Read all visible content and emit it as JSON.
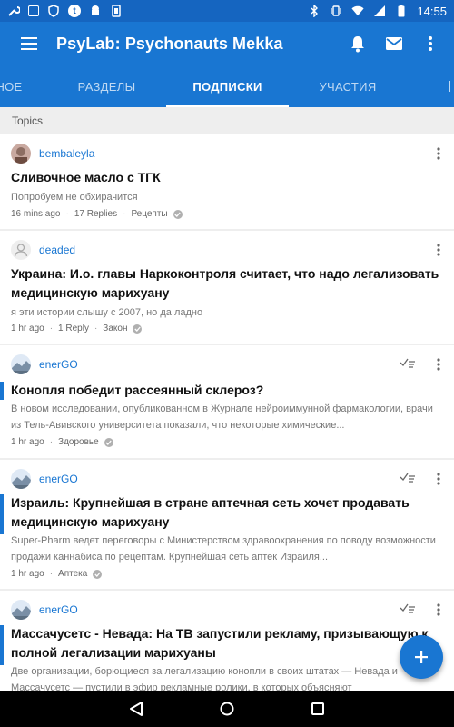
{
  "status_bar": {
    "time": "14:55",
    "left_icons": [
      "wrench-icon",
      "image-icon",
      "shield-icon",
      "tumblr-icon",
      "android-icon",
      "phone-frame-icon"
    ],
    "right_icons": [
      "bluetooth-icon",
      "vibrate-icon",
      "wifi-icon",
      "signal-icon",
      "battery-icon"
    ]
  },
  "app_bar": {
    "title": "PsyLab: Psychonauts Mekka",
    "actions": [
      "bell-icon",
      "mail-icon",
      "overflow-icon"
    ]
  },
  "tabs": [
    {
      "label": "НОЕ",
      "active": false
    },
    {
      "label": "РАЗДЕЛЫ",
      "active": false
    },
    {
      "label": "ПОДПИСКИ",
      "active": true
    },
    {
      "label": "УЧАСТИЯ",
      "active": false
    },
    {
      "label": "",
      "active": false
    }
  ],
  "section_header": "Topics",
  "posts": [
    {
      "author": "bembaleyla",
      "title": "Сливочное масло с ТГК",
      "excerpt": "Попробуем не обхирачится",
      "time": "16 mins ago",
      "replies": "17 Replies",
      "category": "Рецепты",
      "unread": false,
      "read_marker": false
    },
    {
      "author": "deaded",
      "title": "Украина: И.о. главы Наркоконтроля считает, что надо легализовать медицинскую марихуану",
      "excerpt": "я эти истории слышу с 2007, но да ладно",
      "time": "1 hr ago",
      "replies": "1 Reply",
      "category": "Закон",
      "unread": false,
      "read_marker": false
    },
    {
      "author": "enerGO",
      "title": "Конопля победит рассеянный склероз?",
      "excerpt": "В новом исследовании, опубликованном в Журнале нейроиммунной фармакологии, врачи из Тель-Авивского университета показали, что некоторые химические...",
      "time": "1 hr ago",
      "replies": "",
      "category": "Здоровье",
      "unread": true,
      "read_marker": true
    },
    {
      "author": "enerGO",
      "title": "Израиль: Крупнейшая в стране аптечная сеть хочет продавать медицинскую марихуану",
      "excerpt": "Super-Pharm ведет переговоры с Министерством здравоохранения по поводу возможности продажи каннабиса по рецептам. Крупнейшая сеть аптек Израиля...",
      "time": "1 hr ago",
      "replies": "",
      "category": "Аптека",
      "unread": true,
      "read_marker": true
    },
    {
      "author": "enerGO",
      "title": "Массачусетс - Невада: На ТВ запустили рекламу, призывающую к полной легализации марихуаны",
      "excerpt": "Две организации, борющиеся за легализацию конопли в своих штатах — Невада и Массачусетс — пустили в эфир рекламные ролики, в которых объясняют",
      "time": "",
      "replies": "",
      "category": "",
      "unread": true,
      "read_marker": true
    }
  ],
  "fab": {
    "icon": "plus-icon"
  },
  "nav_bar": [
    "back-icon",
    "home-icon",
    "recents-icon"
  ],
  "colors": {
    "primary": "#1976d2",
    "status_bar": "#1565c0",
    "link": "#1976d2"
  }
}
